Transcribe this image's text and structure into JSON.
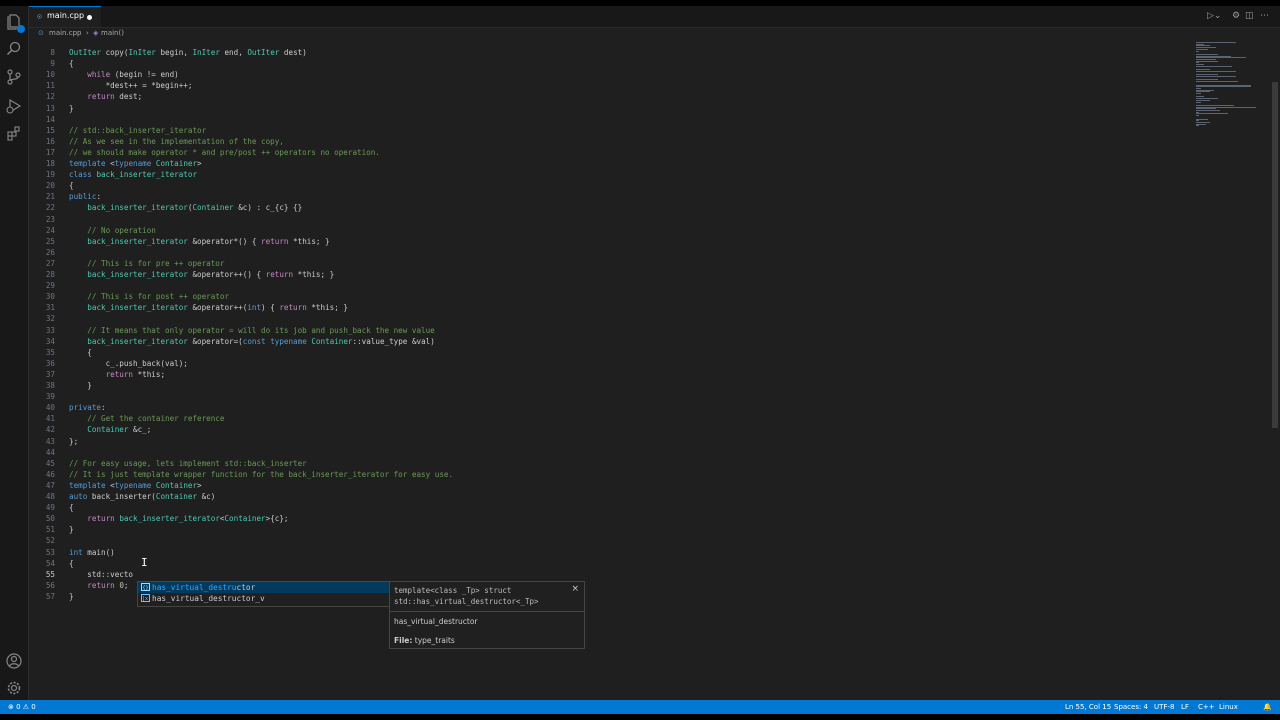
{
  "tab": {
    "filename": "main.cpp",
    "file_icon": "c++-file-icon"
  },
  "breadcrumb": {
    "file": "main.cpp",
    "separator": "›",
    "symbol": "main()"
  },
  "gutter": [
    "8",
    "9",
    "10",
    "11",
    "12",
    "13",
    "14",
    "15",
    "16",
    "17",
    "18",
    "19",
    "20",
    "21",
    "22",
    "23",
    "24",
    "25",
    "26",
    "27",
    "28",
    "29",
    "30",
    "31",
    "32",
    "33",
    "34",
    "35",
    "36",
    "37",
    "38",
    "39",
    "40",
    "41",
    "42",
    "43",
    "44",
    "45",
    "46",
    "47",
    "48",
    "49",
    "50",
    "51",
    "52",
    "53",
    "54",
    "55",
    "56",
    "57"
  ],
  "current_line": "55",
  "code": [
    "OutIter copy(InIter begin, InIter end, OutIter dest)",
    "{",
    "    while (begin != end)",
    "        *dest++ = *begin++;",
    "    return dest;",
    "}",
    "",
    "// std::back_inserter_iterator",
    "// As we see in the implementation of the copy,",
    "// we should make operator * and pre/post ++ operators no operation.",
    "template <typename Container>",
    "class back_inserter_iterator",
    "{",
    "public:",
    "    back_inserter_iterator(Container &c) : c_{c} {}",
    "",
    "    // No operation",
    "    back_inserter_iterator &operator*() { return *this; }",
    "",
    "    // This is for pre ++ operator",
    "    back_inserter_iterator &operator++() { return *this; }",
    "",
    "    // This is for post ++ operator",
    "    back_inserter_iterator &operator++(int) { return *this; }",
    "",
    "    // It means that only operator = will do its job and push_back the new value",
    "    back_inserter_iterator &operator=(const typename Container::value_type &val)",
    "    {",
    "        c_.push_back(val);",
    "        return *this;",
    "    }",
    "",
    "private:",
    "    // Get the container reference",
    "    Container &c_;",
    "};",
    "",
    "// For easy usage, lets implement std::back_inserter",
    "// It is just template wrapper function for the back_inserter_iterator for easy use.",
    "template <typename Container>",
    "auto back_inserter(Container &c)",
    "{",
    "    return back_inserter_iterator<Container>{c};",
    "}",
    "",
    "int main()",
    "{",
    "    std::vecto",
    "    return 0;",
    "}"
  ],
  "suggestions": [
    {
      "match": "has_virtual_destru",
      "rest": "ctor",
      "kind": "struct",
      "selected": true
    },
    {
      "match": "has_virtual_destructor_v",
      "rest": "",
      "kind": "variable",
      "selected": false
    }
  ],
  "details": {
    "signature": "template<class _Tp> struct std::has_virtual_destructor<_Tp>",
    "doc": "has_virtual_destructor",
    "file_label": "File:",
    "file_value": "type_traits"
  },
  "status": {
    "problems": "⊗ 0 ⚠ 0",
    "position": "Ln 55, Col 15",
    "spaces": "Spaces: 4",
    "encoding": "UTF-8",
    "eol": "LF",
    "language": "C++",
    "os": "Linux",
    "bell": "🔔"
  },
  "colors": {
    "accent": "#0078d4",
    "editor_bg": "#1f1f1f",
    "keyword": "#569cd6",
    "comment": "#6a9955",
    "type": "#4ec9b0",
    "function": "#dcdcaa"
  }
}
